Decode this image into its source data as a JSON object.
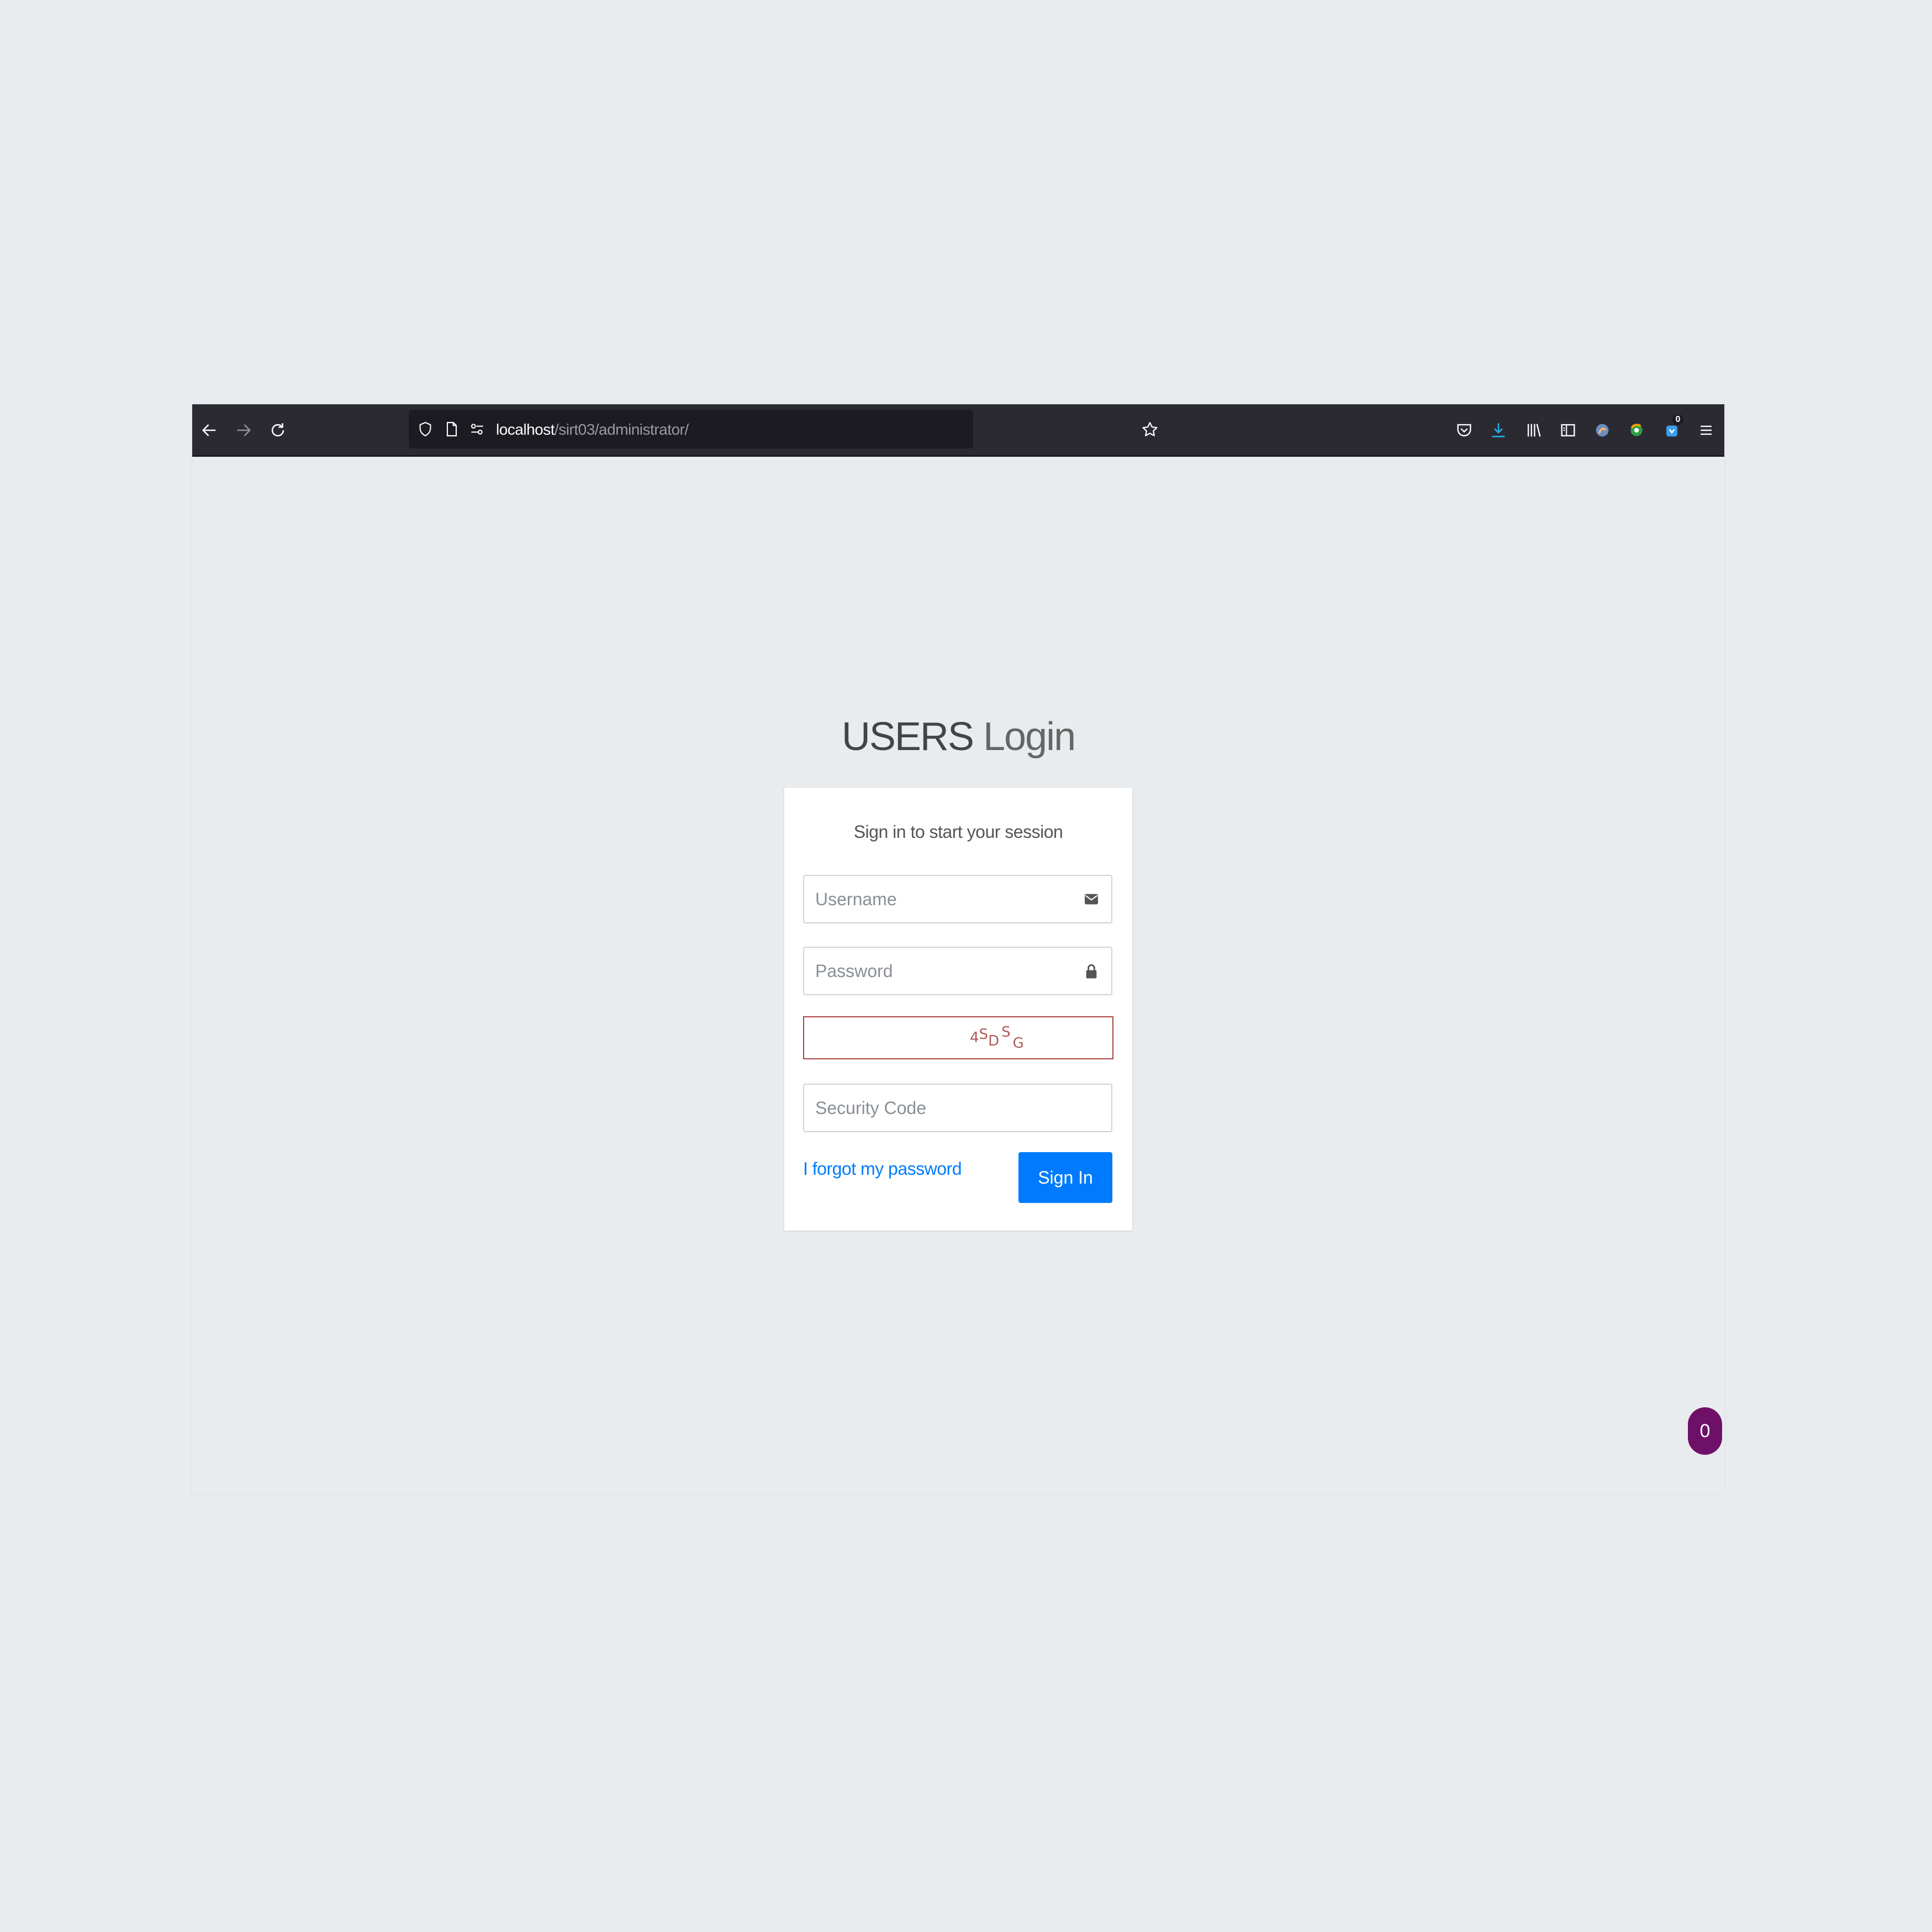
{
  "browser": {
    "url_host": "localhost",
    "url_path": "/sirt03/administrator/",
    "extension_badge": "0"
  },
  "login": {
    "title_bold": "USERS",
    "title_light": "Login",
    "message": "Sign in to start your session",
    "username_placeholder": "Username",
    "password_placeholder": "Password",
    "captcha_chars": [
      "4",
      "S",
      "D",
      "S",
      "G"
    ],
    "security_code_placeholder": "Security Code",
    "forgot_link": "I forgot my password",
    "signin_button": "Sign In"
  },
  "floating_badge": "0",
  "colors": {
    "page_bg": "#e9ecef",
    "toolbar_bg": "#2b2a33",
    "primary": "#007bff",
    "captcha_border": "#a94442",
    "badge_bg": "#6f1068"
  },
  "icons": [
    "back-arrow-icon",
    "forward-arrow-icon",
    "reload-icon",
    "shield-icon",
    "page-icon",
    "permissions-icon",
    "bookmark-star-icon",
    "pocket-icon",
    "download-icon",
    "library-icon",
    "sidebar-icon",
    "extension-icon",
    "envelope-icon",
    "lock-icon",
    "menu-icon"
  ]
}
